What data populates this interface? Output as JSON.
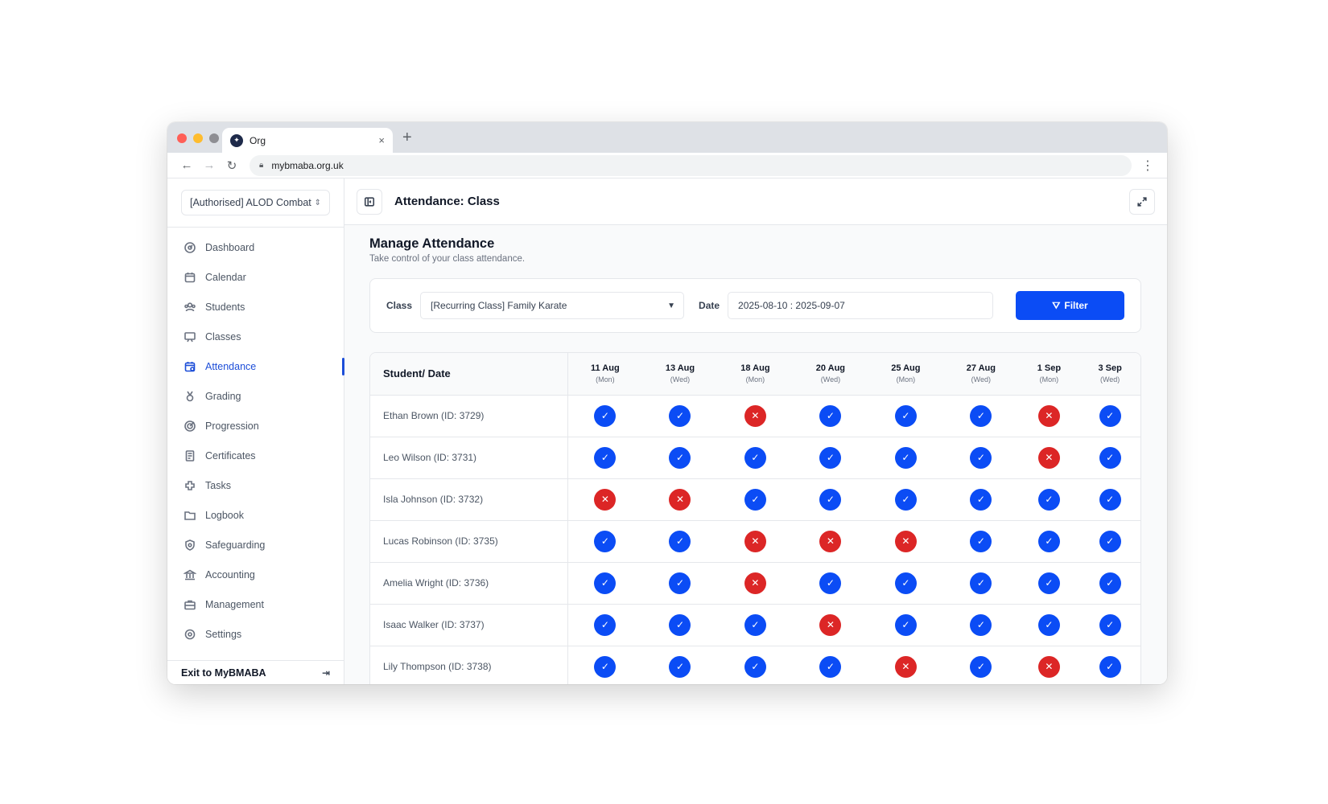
{
  "browser": {
    "tab_title": "Org",
    "favicon_glyph": "✦",
    "tab_close": "×",
    "new_tab": "+",
    "url": "mybmaba.org.uk"
  },
  "sidebar": {
    "org_select": "[Authorised] ALOD Combat",
    "items": [
      {
        "label": "Dashboard",
        "icon": "dashboard-icon"
      },
      {
        "label": "Calendar",
        "icon": "calendar-icon"
      },
      {
        "label": "Students",
        "icon": "students-icon"
      },
      {
        "label": "Classes",
        "icon": "classes-icon"
      },
      {
        "label": "Attendance",
        "icon": "attendance-icon",
        "active": true
      },
      {
        "label": "Grading",
        "icon": "grading-icon"
      },
      {
        "label": "Progression",
        "icon": "progression-icon"
      },
      {
        "label": "Certificates",
        "icon": "certificates-icon"
      },
      {
        "label": "Tasks",
        "icon": "tasks-icon"
      },
      {
        "label": "Logbook",
        "icon": "logbook-icon"
      },
      {
        "label": "Safeguarding",
        "icon": "safeguarding-icon"
      },
      {
        "label": "Accounting",
        "icon": "accounting-icon"
      },
      {
        "label": "Management",
        "icon": "management-icon"
      },
      {
        "label": "Settings",
        "icon": "settings-icon"
      }
    ],
    "exit_label": "Exit to MyBMABA"
  },
  "header": {
    "title": "Attendance: Class"
  },
  "page": {
    "title": "Manage Attendance",
    "subtitle": "Take control of your class attendance."
  },
  "filter": {
    "class_label": "Class",
    "class_value": "[Recurring Class] Family Karate",
    "date_label": "Date",
    "date_value": "2025-08-10 : 2025-09-07",
    "button_label": "Filter"
  },
  "table": {
    "first_header": "Student/ Date",
    "dates": [
      {
        "date": "11 Aug",
        "day": "(Mon)"
      },
      {
        "date": "13 Aug",
        "day": "(Wed)"
      },
      {
        "date": "18 Aug",
        "day": "(Mon)"
      },
      {
        "date": "20 Aug",
        "day": "(Wed)"
      },
      {
        "date": "25 Aug",
        "day": "(Mon)"
      },
      {
        "date": "27 Aug",
        "day": "(Wed)"
      },
      {
        "date": "1 Sep",
        "day": "(Mon)"
      },
      {
        "date": "3 Sep",
        "day": "(Wed)"
      }
    ],
    "rows": [
      {
        "name": "Ethan Brown (ID: 3729)",
        "marks": [
          1,
          1,
          0,
          1,
          1,
          1,
          0,
          1
        ]
      },
      {
        "name": "Leo Wilson (ID: 3731)",
        "marks": [
          1,
          1,
          1,
          1,
          1,
          1,
          0,
          1
        ]
      },
      {
        "name": "Isla Johnson (ID: 3732)",
        "marks": [
          0,
          0,
          1,
          1,
          1,
          1,
          1,
          1
        ]
      },
      {
        "name": "Lucas Robinson (ID: 3735)",
        "marks": [
          1,
          1,
          0,
          0,
          0,
          1,
          1,
          1
        ]
      },
      {
        "name": "Amelia Wright (ID: 3736)",
        "marks": [
          1,
          1,
          0,
          1,
          1,
          1,
          1,
          1
        ]
      },
      {
        "name": "Isaac Walker (ID: 3737)",
        "marks": [
          1,
          1,
          1,
          0,
          1,
          1,
          1,
          1
        ]
      },
      {
        "name": "Lily Thompson (ID: 3738)",
        "marks": [
          1,
          1,
          1,
          1,
          0,
          1,
          0,
          1
        ]
      }
    ]
  },
  "colors": {
    "accent": "#0b4cf5",
    "absent": "#dc2626"
  }
}
